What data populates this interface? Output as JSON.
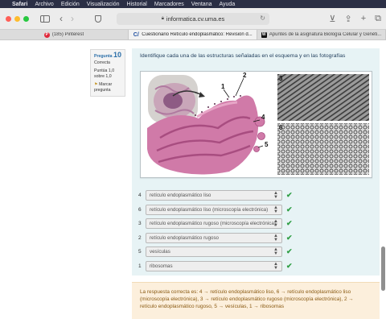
{
  "menubar": {
    "items": [
      "Safari",
      "Archivo",
      "Edición",
      "Visualización",
      "Historial",
      "Marcadores",
      "Ventana",
      "Ayuda"
    ]
  },
  "browser": {
    "url": "informatica.cv.uma.es",
    "tabs": [
      {
        "label": "(185) Pinterest",
        "icon": "pinterest-icon",
        "active": false
      },
      {
        "label": "Cuestionario Retículo endoplasmático: Revisión d...",
        "icon": "moodle-icon",
        "active": true
      },
      {
        "label": "Apuntes de la asignatura Biología Celular y Genéti...",
        "icon": "wuolah-icon",
        "active": false
      }
    ]
  },
  "question_info": {
    "label": "Pregunta",
    "number": "10",
    "state": "Correcta",
    "grade": "Puntúa 1,0 sobre 1,0",
    "flag_label": "Marcar pregunta"
  },
  "question": {
    "text": "Identifique cada una de las estructuras señaladas en el esquema y en las fotografías",
    "figure_labels": [
      "1",
      "2",
      "3",
      "4",
      "5",
      "6"
    ]
  },
  "answers": [
    {
      "number": "4",
      "value": "retículo endoplasmático liso"
    },
    {
      "number": "6",
      "value": "retículo endoplasmático liso (microscopía electrónica)"
    },
    {
      "number": "3",
      "value": "retículo endoplasmático rugoso (microscopía electrónica)"
    },
    {
      "number": "2",
      "value": "retículo endoplasmático rugoso"
    },
    {
      "number": "5",
      "value": "vesículas"
    },
    {
      "number": "1",
      "value": "ribosomas"
    }
  ],
  "feedback": {
    "text": "La respuesta correcta es: 4 → retículo endoplasmático liso, 6 → retículo endoplasmático liso (microscopía electrónica), 3 → retículo endoplasmático rugoso (microscopía electrónica), 2 → retículo endoplasmático rugoso, 5 → vesículas, 1 → ribosomas"
  },
  "colors": {
    "question_bg": "#e7f3f5",
    "feedback_bg": "#fcefdc",
    "correct_check": "#2f9e44"
  }
}
